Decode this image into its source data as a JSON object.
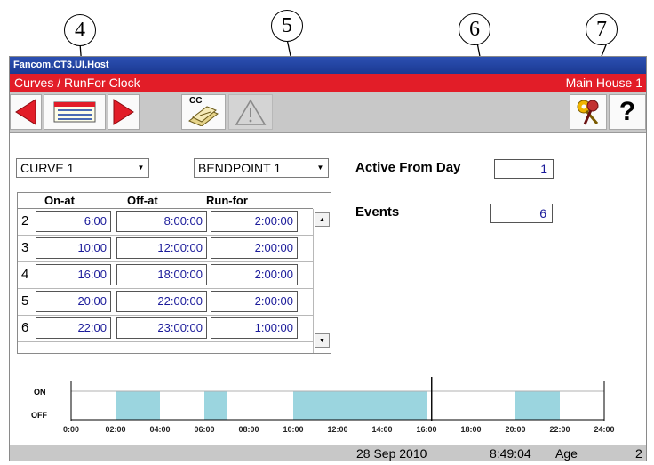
{
  "callouts": [
    "4",
    "5",
    "6",
    "7"
  ],
  "window": {
    "title": "Fancom.CT3.UI.Host",
    "breadcrumb": "Curves / RunFor Clock",
    "house": "Main House 1"
  },
  "toolbar": {
    "prev_icon": "arrow-left-icon",
    "list_icon": "list-icon",
    "next_icon": "arrow-right-icon",
    "cc_label": "CC",
    "cc_icon": "copy-curve-icon",
    "warning_icon": "warning-icon",
    "keys_icon": "keys-icon",
    "help_label": "?"
  },
  "selectors": {
    "curve": "CURVE 1",
    "bendpoint": "BENDPOINT 1"
  },
  "settings": {
    "active_from_day_label": "Active From Day",
    "active_from_day_value": "1",
    "events_label": "Events",
    "events_value": "6"
  },
  "table": {
    "headers": [
      "On-at",
      "Off-at",
      "Run-for"
    ],
    "rows": [
      {
        "n": "2",
        "on": "6:00",
        "off": "8:00:00",
        "run": "2:00:00"
      },
      {
        "n": "3",
        "on": "10:00",
        "off": "12:00:00",
        "run": "2:00:00"
      },
      {
        "n": "4",
        "on": "16:00",
        "off": "18:00:00",
        "run": "2:00:00"
      },
      {
        "n": "5",
        "on": "20:00",
        "off": "22:00:00",
        "run": "2:00:00"
      },
      {
        "n": "6",
        "on": "22:00",
        "off": "23:00:00",
        "run": "1:00:00"
      }
    ]
  },
  "timeline": {
    "on_label": "ON",
    "off_label": "OFF",
    "ticks": [
      "0:00",
      "02:00",
      "04:00",
      "06:00",
      "08:00",
      "10:00",
      "12:00",
      "14:00",
      "16:00",
      "18:00",
      "20:00",
      "22:00",
      "24:00"
    ],
    "on_periods": [
      [
        2,
        4
      ],
      [
        6,
        7
      ],
      [
        10,
        16
      ],
      [
        20,
        22
      ]
    ],
    "current_hour": 16.23,
    "on_color": "#9bd5df"
  },
  "status": {
    "date": "28 Sep 2010",
    "time": "8:49:04",
    "age_label": "Age",
    "age_value": "2"
  }
}
